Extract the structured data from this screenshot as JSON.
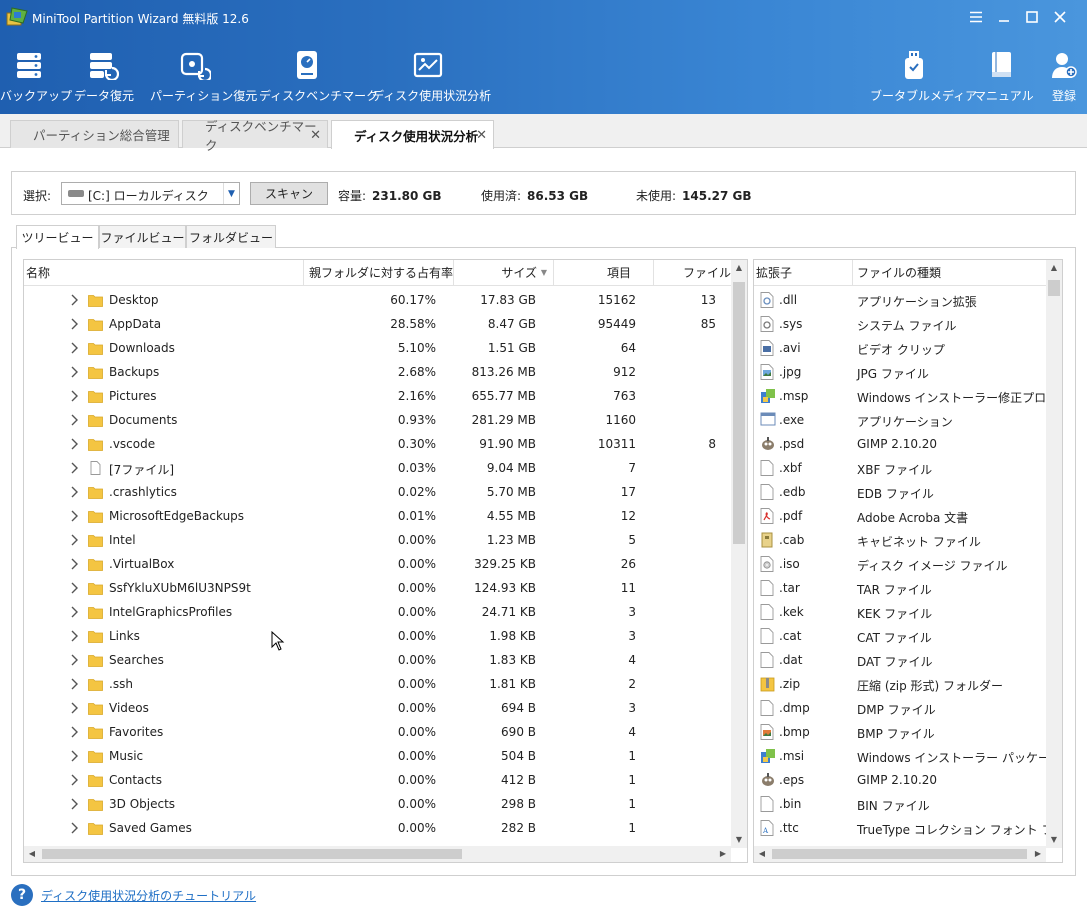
{
  "app": {
    "title": "MiniTool Partition Wizard 無料版 12.6",
    "window_controls": [
      "menu-icon",
      "minimize-icon",
      "maximize-icon",
      "close-icon"
    ]
  },
  "toolbar": {
    "left": [
      {
        "label": "バックアップ",
        "icon": "backup-icon"
      },
      {
        "label": "データ復元",
        "icon": "data-recovery-icon"
      },
      {
        "label": "パーティション復元",
        "icon": "partition-recovery-icon"
      },
      {
        "label": "ディスクベンチマーク",
        "icon": "disk-benchmark-icon"
      },
      {
        "label": "ディスク使用状況分析",
        "icon": "space-analyzer-icon"
      }
    ],
    "right": [
      {
        "label": "ブータブルメディア",
        "icon": "bootable-media-icon"
      },
      {
        "label": "マニュアル",
        "icon": "manual-icon"
      },
      {
        "label": "登録",
        "icon": "register-icon"
      }
    ]
  },
  "tabs": [
    {
      "label": "パーティション総合管理",
      "closable": false,
      "active": false
    },
    {
      "label": "ディスクベンチマーク",
      "closable": true,
      "active": false
    },
    {
      "label": "ディスク使用状況分析",
      "closable": true,
      "active": true
    }
  ],
  "selection": {
    "label": "選択:",
    "drive": "[C:] ローカルディスク",
    "scan_button": "スキャン",
    "capacity_label": "容量:",
    "capacity": "231.80 GB",
    "used_label": "使用済:",
    "used": "86.53 GB",
    "free_label": "未使用:",
    "free": "145.27 GB"
  },
  "view_tabs": [
    {
      "label": "ツリービュー",
      "active": true
    },
    {
      "label": "ファイルビュー",
      "active": false
    },
    {
      "label": "フォルダビュー",
      "active": false
    }
  ],
  "tree": {
    "columns": {
      "name": "名称",
      "percent": "親フォルダに対する占有率",
      "size": "サイズ",
      "items": "項目",
      "files": "ファイル"
    },
    "rows": [
      {
        "name": "Desktop",
        "percent": "60.17%",
        "size": "17.83 GB",
        "items": "15162",
        "files": "13",
        "type": "folder"
      },
      {
        "name": "AppData",
        "percent": "28.58%",
        "size": "8.47 GB",
        "items": "95449",
        "files": "85",
        "type": "folder"
      },
      {
        "name": "Downloads",
        "percent": "5.10%",
        "size": "1.51 GB",
        "items": "64",
        "files": "",
        "type": "folder"
      },
      {
        "name": "Backups",
        "percent": "2.68%",
        "size": "813.26 MB",
        "items": "912",
        "files": "",
        "type": "folder"
      },
      {
        "name": "Pictures",
        "percent": "2.16%",
        "size": "655.77 MB",
        "items": "763",
        "files": "",
        "type": "folder"
      },
      {
        "name": "Documents",
        "percent": "0.93%",
        "size": "281.29 MB",
        "items": "1160",
        "files": "",
        "type": "folder"
      },
      {
        "name": ".vscode",
        "percent": "0.30%",
        "size": "91.90 MB",
        "items": "10311",
        "files": "8",
        "type": "folder"
      },
      {
        "name": "[7ファイル]",
        "percent": "0.03%",
        "size": "9.04 MB",
        "items": "7",
        "files": "",
        "type": "file"
      },
      {
        "name": ".crashlytics",
        "percent": "0.02%",
        "size": "5.70 MB",
        "items": "17",
        "files": "",
        "type": "folder"
      },
      {
        "name": "MicrosoftEdgeBackups",
        "percent": "0.01%",
        "size": "4.55 MB",
        "items": "12",
        "files": "",
        "type": "folder"
      },
      {
        "name": "Intel",
        "percent": "0.00%",
        "size": "1.23 MB",
        "items": "5",
        "files": "",
        "type": "folder"
      },
      {
        "name": ".VirtualBox",
        "percent": "0.00%",
        "size": "329.25 KB",
        "items": "26",
        "files": "",
        "type": "folder"
      },
      {
        "name": "SsfYkluXUbM6lU3NPS9t",
        "percent": "0.00%",
        "size": "124.93 KB",
        "items": "11",
        "files": "",
        "type": "folder"
      },
      {
        "name": "IntelGraphicsProfiles",
        "percent": "0.00%",
        "size": "24.71 KB",
        "items": "3",
        "files": "",
        "type": "folder"
      },
      {
        "name": "Links",
        "percent": "0.00%",
        "size": "1.98 KB",
        "items": "3",
        "files": "",
        "type": "folder"
      },
      {
        "name": "Searches",
        "percent": "0.00%",
        "size": "1.83 KB",
        "items": "4",
        "files": "",
        "type": "folder"
      },
      {
        "name": ".ssh",
        "percent": "0.00%",
        "size": "1.81 KB",
        "items": "2",
        "files": "",
        "type": "folder"
      },
      {
        "name": "Videos",
        "percent": "0.00%",
        "size": "694 B",
        "items": "3",
        "files": "",
        "type": "folder"
      },
      {
        "name": "Favorites",
        "percent": "0.00%",
        "size": "690 B",
        "items": "4",
        "files": "",
        "type": "folder"
      },
      {
        "name": "Music",
        "percent": "0.00%",
        "size": "504 B",
        "items": "1",
        "files": "",
        "type": "folder"
      },
      {
        "name": "Contacts",
        "percent": "0.00%",
        "size": "412 B",
        "items": "1",
        "files": "",
        "type": "folder"
      },
      {
        "name": "3D Objects",
        "percent": "0.00%",
        "size": "298 B",
        "items": "1",
        "files": "",
        "type": "folder"
      },
      {
        "name": "Saved Games",
        "percent": "0.00%",
        "size": "282 B",
        "items": "1",
        "files": "",
        "type": "folder"
      }
    ]
  },
  "extensions": {
    "columns": {
      "ext": "拡張子",
      "type": "ファイルの種類"
    },
    "rows": [
      {
        "ext": ".dll",
        "type": "アプリケーション拡張",
        "icon": "dll-file-icon"
      },
      {
        "ext": ".sys",
        "type": "システム ファイル",
        "icon": "system-file-icon"
      },
      {
        "ext": ".avi",
        "type": "ビデオ クリップ",
        "icon": "video-file-icon"
      },
      {
        "ext": ".jpg",
        "type": "JPG ファイル",
        "icon": "image-file-icon"
      },
      {
        "ext": ".msp",
        "type": "Windows インストーラー修正プログラム",
        "icon": "installer-icon"
      },
      {
        "ext": ".exe",
        "type": "アプリケーション",
        "icon": "application-icon"
      },
      {
        "ext": ".psd",
        "type": "GIMP 2.10.20",
        "icon": "gimp-icon"
      },
      {
        "ext": ".xbf",
        "type": "XBF ファイル",
        "icon": "blank-file-icon"
      },
      {
        "ext": ".edb",
        "type": "EDB ファイル",
        "icon": "blank-file-icon"
      },
      {
        "ext": ".pdf",
        "type": "Adobe Acroba 文書",
        "icon": "pdf-file-icon"
      },
      {
        "ext": ".cab",
        "type": "キャビネット ファイル",
        "icon": "cabinet-file-icon"
      },
      {
        "ext": ".iso",
        "type": "ディスク イメージ ファイル",
        "icon": "disc-image-icon"
      },
      {
        "ext": ".tar",
        "type": "TAR ファイル",
        "icon": "blank-file-icon"
      },
      {
        "ext": ".kek",
        "type": "KEK ファイル",
        "icon": "blank-file-icon"
      },
      {
        "ext": ".cat",
        "type": "CAT ファイル",
        "icon": "blank-file-icon"
      },
      {
        "ext": ".dat",
        "type": "DAT ファイル",
        "icon": "blank-file-icon"
      },
      {
        "ext": ".zip",
        "type": "圧縮 (zip 形式) フォルダー",
        "icon": "zip-folder-icon"
      },
      {
        "ext": ".dmp",
        "type": "DMP ファイル",
        "icon": "blank-file-icon"
      },
      {
        "ext": ".bmp",
        "type": "BMP ファイル",
        "icon": "bitmap-file-icon"
      },
      {
        "ext": ".msi",
        "type": "Windows インストーラー パッケージ",
        "icon": "installer-icon"
      },
      {
        "ext": ".eps",
        "type": "GIMP 2.10.20",
        "icon": "gimp-icon"
      },
      {
        "ext": ".bin",
        "type": "BIN ファイル",
        "icon": "blank-file-icon"
      },
      {
        "ext": ".ttc",
        "type": "TrueType コレクション フォント ファイル",
        "icon": "font-file-icon"
      }
    ]
  },
  "help": {
    "link": "ディスク使用状況分析のチュートリアル"
  },
  "colors": {
    "header_dark": "#1f5fb0",
    "header_light": "#4a96dd",
    "link": "#1f6fc5",
    "folder": "#f4c542"
  }
}
